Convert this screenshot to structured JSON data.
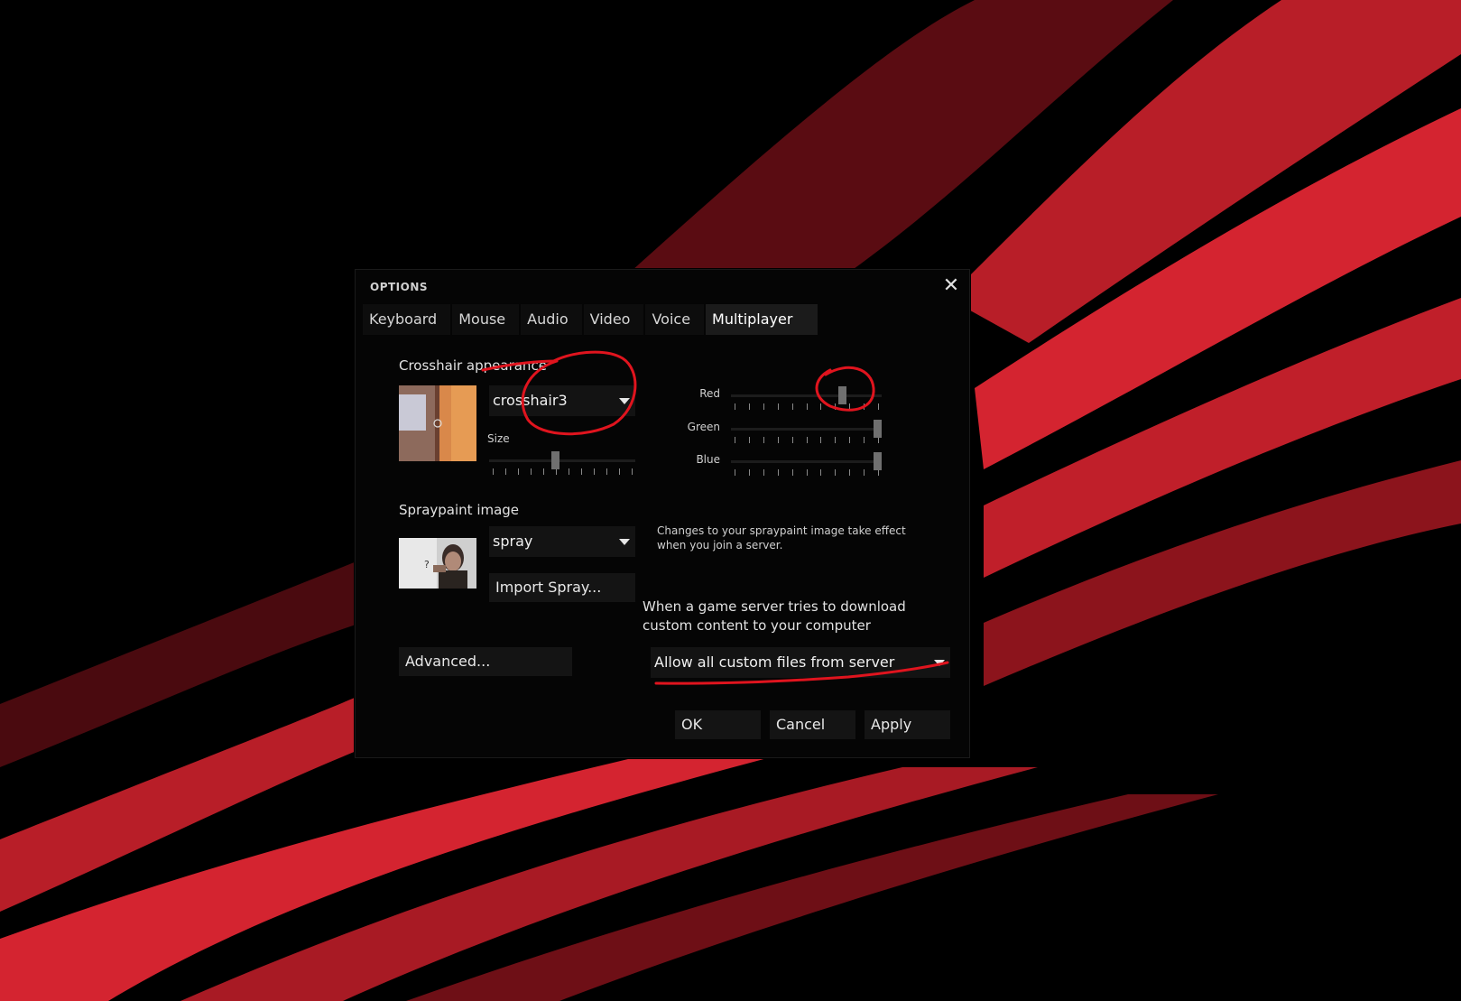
{
  "window": {
    "title": "OPTIONS",
    "close_icon": "close-icon"
  },
  "tabs": [
    {
      "label": "Keyboard"
    },
    {
      "label": "Mouse"
    },
    {
      "label": "Audio"
    },
    {
      "label": "Video"
    },
    {
      "label": "Voice"
    },
    {
      "label": "Multiplayer",
      "active": true
    }
  ],
  "crosshair": {
    "heading": "Crosshair appearance",
    "selected": "crosshair3",
    "size_label": "Size",
    "size_level": 0.45
  },
  "color": {
    "red_label": "Red",
    "red_level": 0.75,
    "green_label": "Green",
    "green_level": 1.0,
    "blue_label": "Blue",
    "blue_level": 1.0
  },
  "spray": {
    "heading": "Spraypaint image",
    "selected": "spray",
    "import_label": "Import Spray...",
    "note_line1": "Changes to your spraypaint image take effect",
    "note_line2": "when you join a server."
  },
  "download": {
    "line1": "When a game server tries to download",
    "line2": "custom content to your computer",
    "selected": "Allow all custom files from server"
  },
  "buttons": {
    "advanced": "Advanced...",
    "ok": "OK",
    "cancel": "Cancel",
    "apply": "Apply"
  },
  "colors": {
    "background": "#000000",
    "stripe_red": "#d42430",
    "stripe_dark": "#6e0f16",
    "annotation": "#e0141e",
    "dialog": "#050505"
  }
}
